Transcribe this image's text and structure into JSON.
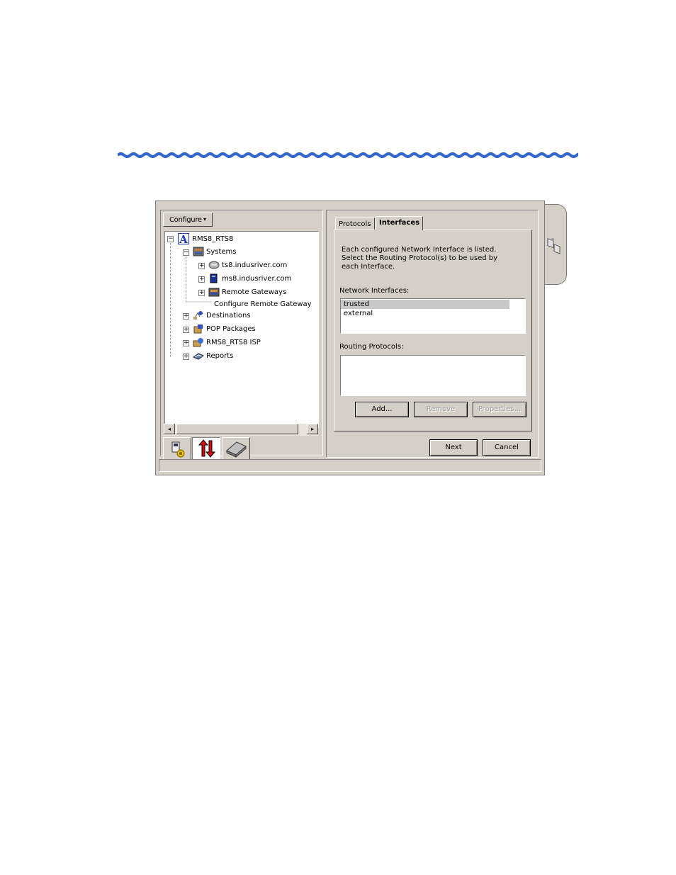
{
  "config": {
    "label": "Configure",
    "arrow": "▾"
  },
  "tree": {
    "root": "RMS8_RTS8",
    "systems": "Systems",
    "ts8": "ts8.indusriver.com",
    "ms8": "ms8.indusriver.com",
    "gateways": "Remote Gateways",
    "configure_gateway": "Configure Remote Gateway",
    "destinations": "Destinations",
    "pop": "POP Packages",
    "isp": "RMS8_RTS8 ISP",
    "reports": "Reports"
  },
  "tabs": {
    "protocols": "Protocols",
    "interfaces": "Interfaces"
  },
  "panel": {
    "desc1": "Each configured Network Interface is listed.",
    "desc2": "Select the Routing Protocol(s) to be used by",
    "desc3": "each Interface.",
    "net_label": "Network Interfaces:",
    "net_items": [
      "trusted",
      "external"
    ],
    "routing_label": "Routing Protocols:"
  },
  "buttons": {
    "add": "Add...",
    "remove": "Remove",
    "properties": "Properties...",
    "next": "Next",
    "cancel": "Cancel"
  },
  "colors": {
    "face": "#d4d0c8",
    "wave": "#3366cc",
    "logo": "#1a3bbf"
  }
}
